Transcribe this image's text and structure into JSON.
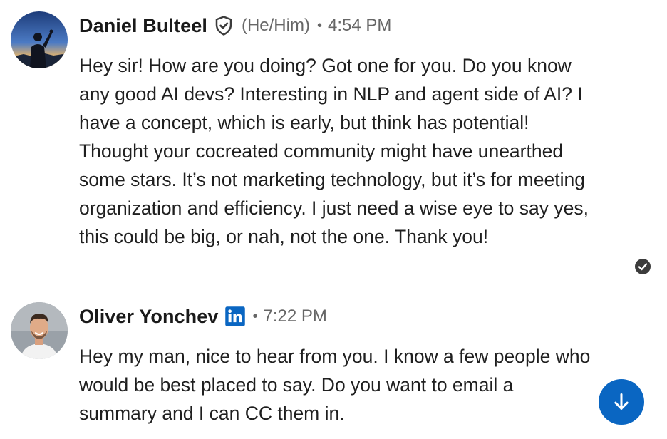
{
  "messages": [
    {
      "sender": "Daniel Bulteel",
      "pronouns": "(He/Him)",
      "separator": "•",
      "time": "4:54 PM",
      "badge_icon": "verified-shield-icon",
      "avatar_icon": "person-silhouette-sunset-avatar",
      "body": "Hey sir! How are you doing? Got one for you. Do you know any good AI devs? Interesting in NLP and agent side of AI? I have a concept, which is early, but think has potential! Thought your cocreated community might have unearthed some stars. It’s not marketing technology, but it’s for meeting organization and efficiency. I just need a wise eye to say yes, this could be big, or nah, not the one. Thank you!",
      "status_icon": "seen-check-icon"
    },
    {
      "sender": "Oliver Yonchev",
      "separator": "•",
      "time": "7:22 PM",
      "badge_icon": "linkedin-icon",
      "avatar_icon": "person-photo-avatar",
      "body": "Hey my man, nice to hear from you. I know a few people who would be best placed to say. Do you want to email a summary and I can CC them in."
    }
  ],
  "scroll_button_icon": "arrow-down-icon",
  "colors": {
    "accent": "#0a66c2",
    "name_text": "#191919",
    "meta_text": "#666666",
    "body_text": "#1f1f1f",
    "status_icon": "#3c3c3c"
  }
}
